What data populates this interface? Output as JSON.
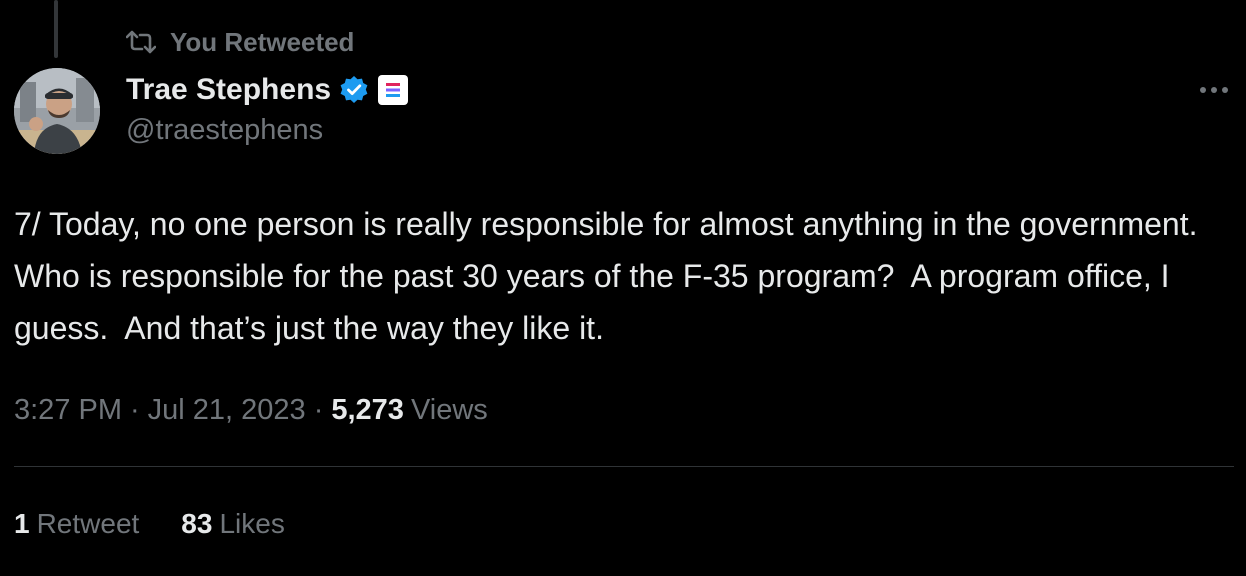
{
  "retweet_context": {
    "icon": "retweet-icon",
    "label": "You Retweeted"
  },
  "author": {
    "display_name": "Trae Stephens",
    "handle": "@traestephens",
    "avatar_icon": "avatar",
    "verified_icon": "verified-badge-icon",
    "affiliate_icon": "affiliate-badge-icon",
    "verified_color": "#1d9bf0"
  },
  "more_menu_icon": "more-horizontal-icon",
  "tweet": {
    "text": "7/ Today, no one person is really responsible for almost anything in the government. Who is responsible for the past 30 years of the F-35 program?  A program office, I guess.  And that’s just the way they like it.",
    "time": "3:27 PM",
    "date": "Jul 21, 2023",
    "separator": "·",
    "views_count": "5,273",
    "views_label": "Views"
  },
  "stats": {
    "retweets_count": "1",
    "retweets_label": "Retweet",
    "likes_count": "83",
    "likes_label": "Likes"
  },
  "colors": {
    "background": "#000000",
    "text_primary": "#e7e9ea",
    "text_secondary": "#71767b",
    "divider": "#2f3336"
  }
}
